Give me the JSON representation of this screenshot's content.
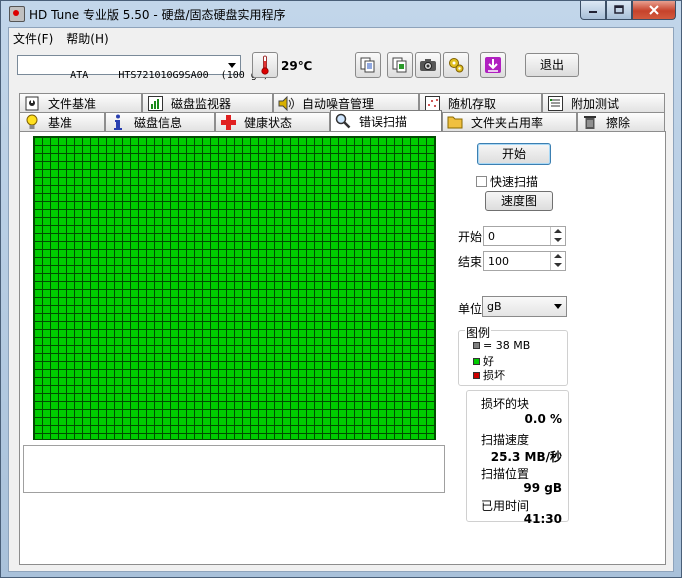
{
  "window": {
    "title": "HD Tune 专业版 5.50 - 硬盘/固态硬盘实用程序"
  },
  "menu": [
    {
      "label": "文件(F)"
    },
    {
      "label": "帮助(H)"
    }
  ],
  "toolbar": {
    "drive": "ATA     HTS721010G9SA00  (100 gB)",
    "temperature": "29℃",
    "exit_label": "退出"
  },
  "tabs_back": [
    {
      "label": "文件基准",
      "icon": "file-benchmark-icon"
    },
    {
      "label": "磁盘监视器",
      "icon": "disk-monitor-icon"
    },
    {
      "label": "自动噪音管理",
      "icon": "speaker-icon"
    },
    {
      "label": "随机存取",
      "icon": "random-access-icon"
    },
    {
      "label": "附加测试",
      "icon": "extra-tests-icon"
    }
  ],
  "tabs_front": [
    {
      "label": "基准",
      "icon": "lightbulb-icon"
    },
    {
      "label": "磁盘信息",
      "icon": "info-icon"
    },
    {
      "label": "健康状态",
      "icon": "health-cross-icon"
    },
    {
      "label": "错误扫描",
      "icon": "magnifier-icon",
      "active": true
    },
    {
      "label": "文件夹占用率",
      "icon": "folder-icon"
    },
    {
      "label": "擦除",
      "icon": "trash-icon"
    }
  ],
  "scan": {
    "start_label": "开始",
    "quick_scan_label": "快速扫描",
    "quick_scan_checked": false,
    "speed_map_label": "速度图",
    "start_field_label": "开始",
    "start_value": "0",
    "end_field_label": "结束",
    "end_value": "100",
    "unit_label": "单位",
    "unit_value": "gB"
  },
  "legend": {
    "title": "图例",
    "block_size": "= 38 MB",
    "good": "好",
    "bad": "损坏",
    "colors": {
      "block": "#808080",
      "good": "#00cc00",
      "bad": "#cc0000"
    }
  },
  "stats": {
    "damaged_label": "损坏的块",
    "damaged_value": "0.0 %",
    "speed_label": "扫描速度",
    "speed_value": "25.3 MB/秒",
    "position_label": "扫描位置",
    "position_value": "99 gB",
    "time_label": "已用时间",
    "time_value": "41:30"
  }
}
